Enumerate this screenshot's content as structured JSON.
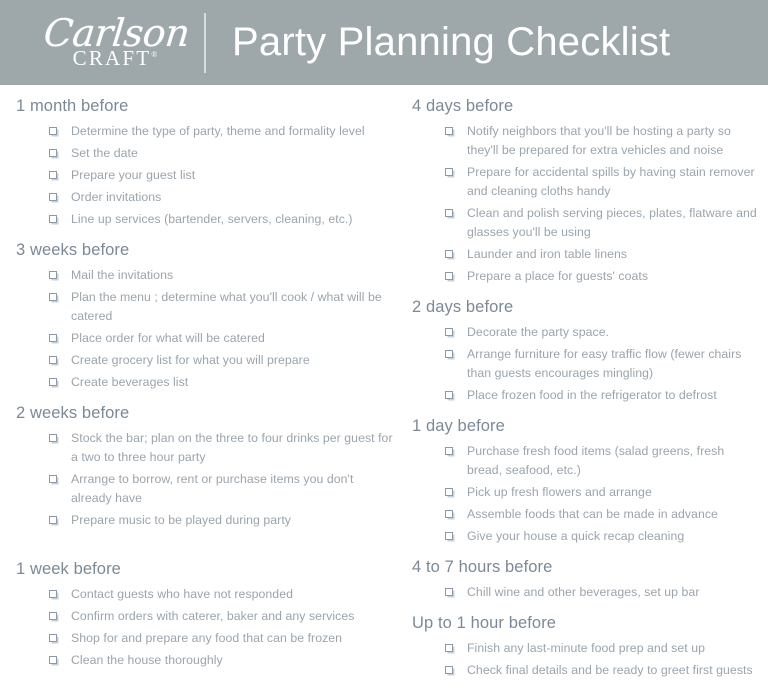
{
  "header": {
    "logo_script": "Carlson",
    "logo_word": "CRAFT",
    "logo_trademark": "®",
    "title": "Party Planning Checklist",
    "background_color": "#9ea7aa",
    "text_color": "#ffffff"
  },
  "colors": {
    "heading": "#7c8996",
    "item_text": "#9ba4ac",
    "checkbox_border": "#8d99a6",
    "divider": "#d7dcdd"
  },
  "icons": {
    "checkbox": "checkbox-icon"
  },
  "left_column": [
    {
      "title": "1 month before",
      "extra_gap": false,
      "items": [
        "Determine the type of party, theme and formality level",
        "Set the date",
        "Prepare your guest list",
        "Order invitations",
        "Line up services (bartender, servers, cleaning, etc.)"
      ]
    },
    {
      "title": "3 weeks before",
      "extra_gap": false,
      "items": [
        "Mail the invitations",
        "Plan the menu ; determine what you'll cook / what will be catered",
        "Place order for what will be catered",
        "Create grocery list for what you will prepare",
        "Create beverages list"
      ]
    },
    {
      "title": "2 weeks before",
      "extra_gap": false,
      "items": [
        "Stock the bar; plan on the three to four drinks per guest for a two to three hour party",
        "Arrange to borrow, rent or purchase items you don't already have",
        "Prepare music to be played during party"
      ]
    },
    {
      "title": "1 week before",
      "extra_gap": true,
      "items": [
        "Contact guests who have not responded",
        "Confirm orders with caterer, baker and any services",
        "Shop for and prepare any food that can be frozen",
        "Clean the house thoroughly"
      ]
    }
  ],
  "right_column": [
    {
      "title": "4 days before",
      "extra_gap": false,
      "items": [
        "Notify neighbors that you'll be hosting a party so they'll be prepared for extra vehicles and noise",
        "Prepare for accidental spills by having stain remover and cleaning cloths handy",
        "Clean and polish serving pieces, plates, flatware and glasses you'll be using",
        "Launder and iron table linens",
        "Prepare a place for guests' coats"
      ]
    },
    {
      "title": "2 days before",
      "extra_gap": false,
      "items": [
        "Decorate the party space.",
        "Arrange furniture for easy traffic flow (fewer chairs than guests encourages mingling)",
        "Place frozen food in the refrigerator to defrost"
      ]
    },
    {
      "title": "1 day before",
      "extra_gap": false,
      "items": [
        "Purchase fresh food items (salad greens, fresh bread, seafood, etc.)",
        "Pick up fresh flowers and arrange",
        "Assemble foods that can be made in advance",
        "Give your house a quick recap cleaning"
      ]
    },
    {
      "title": "4 to 7 hours before",
      "extra_gap": false,
      "items": [
        "Chill wine and other beverages, set up bar"
      ]
    },
    {
      "title": "Up to 1 hour before",
      "extra_gap": false,
      "items": [
        "Finish any last-minute food prep and set up",
        "Check final details and be ready to greet first guests"
      ]
    }
  ]
}
